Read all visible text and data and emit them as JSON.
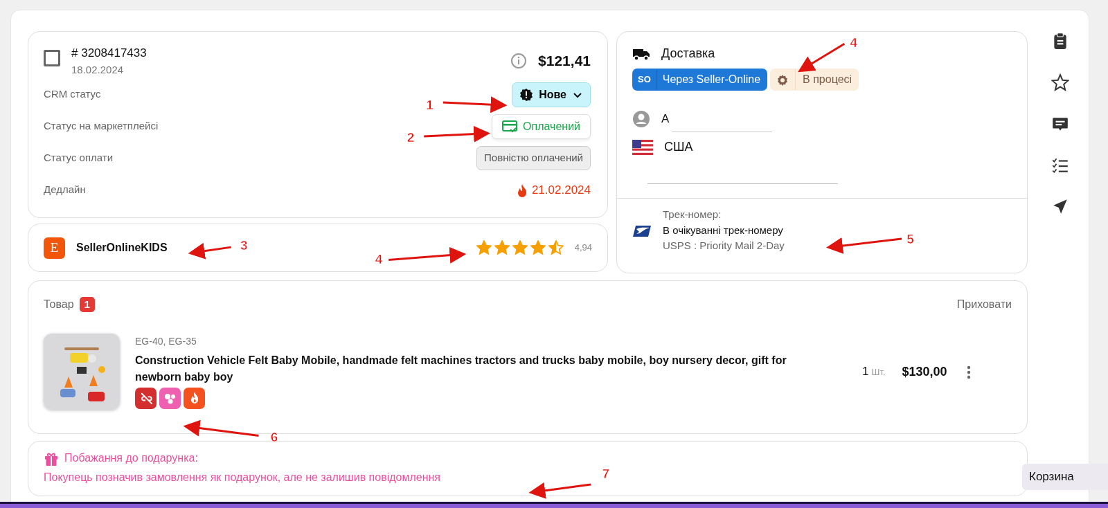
{
  "order": {
    "checked": false,
    "number": "# 3208417433",
    "date": "18.02.2024",
    "total": "$121,41",
    "fields": [
      {
        "label": "CRM статус",
        "kind": "crm",
        "value": "Нове"
      },
      {
        "label": "Статус на маркетплейсі",
        "kind": "market",
        "value": "Оплачений"
      },
      {
        "label": "Статус оплати",
        "kind": "payment",
        "value": "Повністю оплачений"
      },
      {
        "label": "Дедлайн",
        "kind": "deadline",
        "value": "21.02.2024"
      }
    ]
  },
  "shop": {
    "logo": "E",
    "name": "SellerOnlineKIDS",
    "stars": 4.5,
    "rating": "4,94"
  },
  "delivery": {
    "title": "Доставка",
    "method": {
      "logo": "SO",
      "label": "Через Seller-Online"
    },
    "state": "В процесі",
    "customer": "А",
    "country": "США",
    "track_label": "Трек-номер:",
    "track_status": "В очікуванні трек-номеру",
    "carrier": "USPS : Priority Mail 2-Day"
  },
  "products": {
    "title": "Товар",
    "count": "1",
    "hide": "Приховати",
    "items": [
      {
        "kind": "picture",
        "sku": "EG-40, EG-35",
        "name": "Construction Vehicle Felt Baby Mobile, handmade felt machines tractors and trucks baby mobile, boy nursery decor, gift for newborn baby boy",
        "qty": "1",
        "unit": "Шт.",
        "price": "$130,00",
        "tags": [
          {
            "kind": "unlinked",
            "color": "#d32f2f"
          },
          {
            "kind": "dots",
            "color": "#f060b0"
          },
          {
            "kind": "fire",
            "color": "#f4511e"
          }
        ]
      }
    ]
  },
  "gift": {
    "title": "Побажання до подарунка:",
    "text": "Покупець позначив замовлення як подарунок, але не залишив повідомлення"
  },
  "sidebar": [
    {
      "kind": "clipboard"
    },
    {
      "kind": "star"
    },
    {
      "kind": "comment"
    },
    {
      "kind": "checklist"
    },
    {
      "kind": "send"
    }
  ],
  "tooltip": "Корзина",
  "annotations": [
    {
      "label": "1"
    },
    {
      "label": "2"
    },
    {
      "label": "3"
    },
    {
      "label": "4"
    },
    {
      "label": "4"
    },
    {
      "label": "5"
    },
    {
      "label": "6"
    },
    {
      "label": "7"
    }
  ]
}
